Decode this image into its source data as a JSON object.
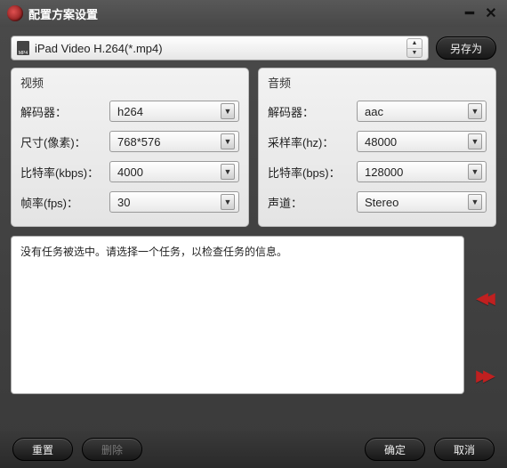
{
  "window": {
    "title": "配置方案设置"
  },
  "profile": {
    "label": "iPad Video H.264(*.mp4)"
  },
  "buttons": {
    "saveAs": "另存为",
    "reset": "重置",
    "delete": "删除",
    "ok": "确定",
    "cancel": "取消"
  },
  "video": {
    "title": "视频",
    "decoder_label": "解码器：",
    "decoder": "h264",
    "size_label": "尺寸(像素)：",
    "size": "768*576",
    "bitrate_label": "比特率(kbps)：",
    "bitrate": "4000",
    "fps_label": "帧率(fps)：",
    "fps": "30"
  },
  "audio": {
    "title": "音频",
    "decoder_label": "解码器：",
    "decoder": "aac",
    "samplerate_label": "采样率(hz)：",
    "samplerate": "48000",
    "bitrate_label": "比特率(bps)：",
    "bitrate": "128000",
    "channel_label": "声道：",
    "channel": "Stereo"
  },
  "info": {
    "message": "没有任务被选中。请选择一个任务，以检查任务的信息。"
  }
}
